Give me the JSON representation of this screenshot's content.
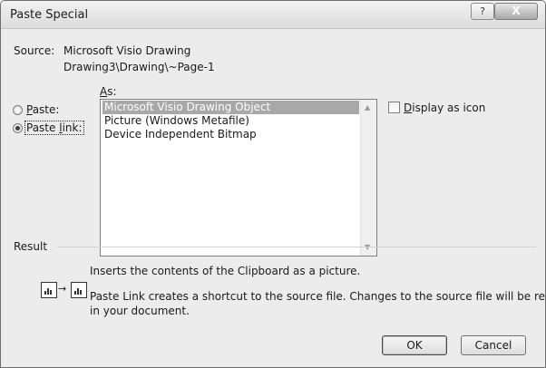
{
  "window": {
    "title": "Paste Special",
    "help_glyph": "?",
    "close_glyph": "X"
  },
  "source": {
    "label": "Source:",
    "line1": "Microsoft Visio Drawing",
    "line2": "Drawing3\\Drawing\\~Page-1"
  },
  "as_label": "As:",
  "radios": {
    "paste": {
      "label": "Paste:",
      "selected": false
    },
    "paste_link": {
      "label": "Paste link:",
      "selected": true
    }
  },
  "as_list": {
    "items": [
      "Microsoft Visio Drawing Object",
      "Picture (Windows Metafile)",
      "Device Independent Bitmap"
    ],
    "selected_index": 0
  },
  "display_as_icon": {
    "label": "Display as icon",
    "checked": false
  },
  "result": {
    "label": "Result",
    "line1": "Inserts the contents of the Clipboard as a picture.",
    "line2a": "Paste Link creates a shortcut to the source file. Changes to the source file will be reflected",
    "line2b": "in your document."
  },
  "buttons": {
    "ok": "OK",
    "cancel": "Cancel"
  }
}
